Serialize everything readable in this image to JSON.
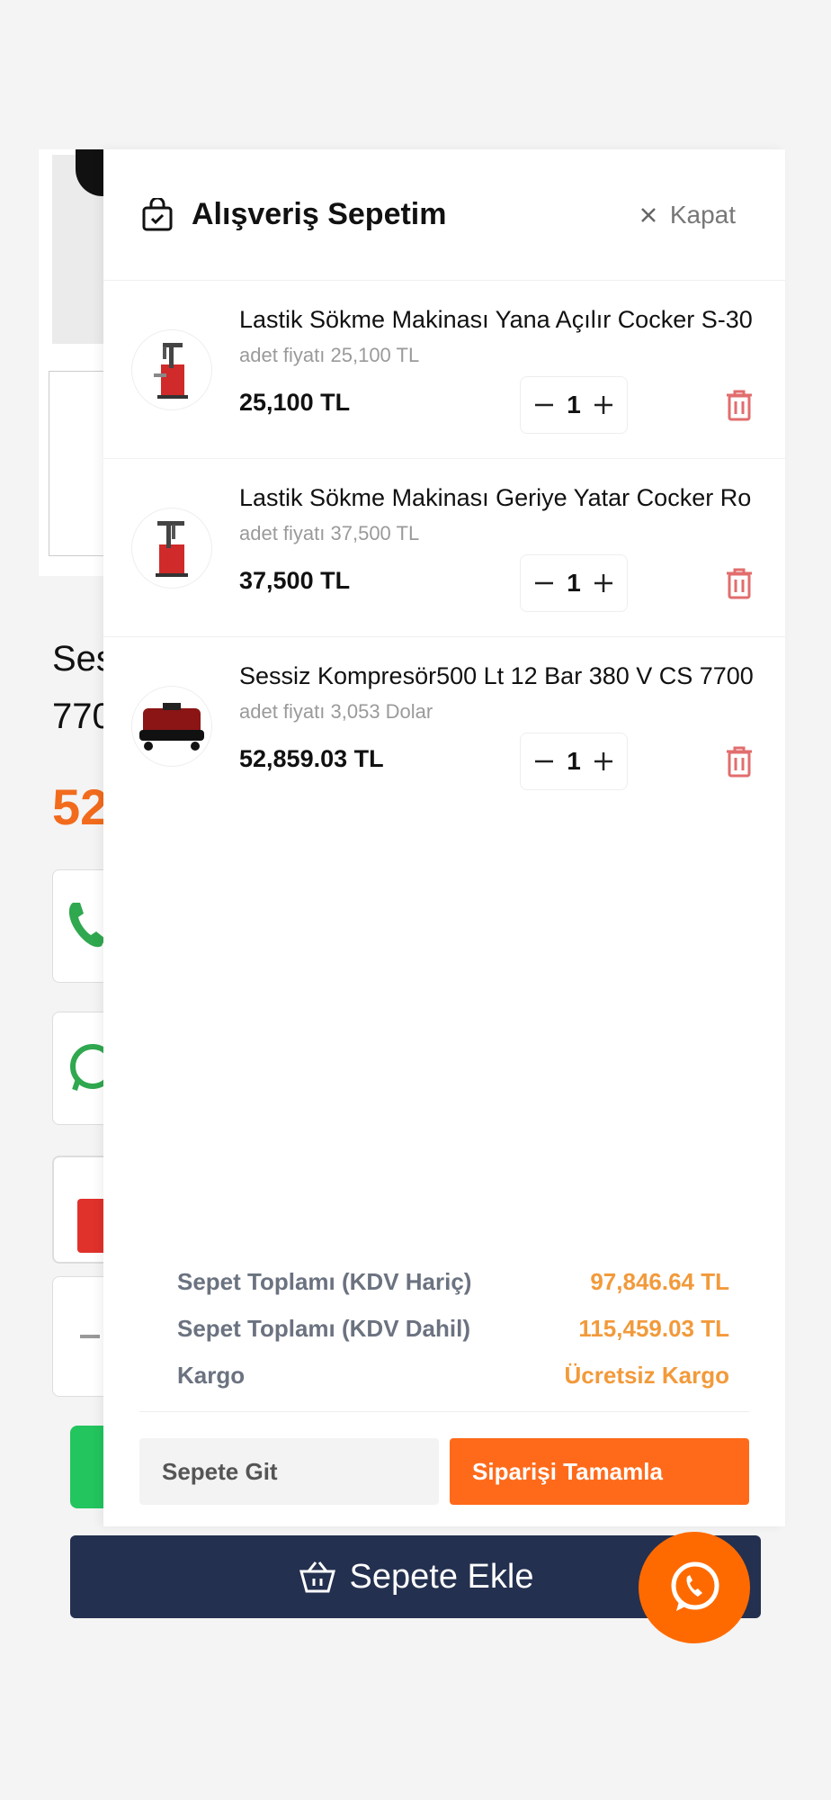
{
  "background": {
    "title_fragment_1": "Ses",
    "title_fragment_2": "770",
    "price_fragment": "52",
    "add_to_cart_label": "Sepete Ekle"
  },
  "cart": {
    "title": "Alışveriş Sepetim",
    "close_label": "Kapat",
    "items": [
      {
        "name": "Lastik Sökme Makinası Yana Açılır Cocker S-30",
        "unit_price": "adet fiyatı 25,100 TL",
        "total": "25,100 TL",
        "quantity": "1"
      },
      {
        "name": "Lastik Sökme Makinası Geriye Yatar Cocker Ro",
        "unit_price": "adet fiyatı 37,500 TL",
        "total": "37,500 TL",
        "quantity": "1"
      },
      {
        "name": "Sessiz Kompresör500 Lt 12 Bar 380 V CS 7700",
        "unit_price": "adet fiyatı 3,053 Dolar",
        "total": "52,859.03 TL",
        "quantity": "1"
      }
    ],
    "summary": [
      {
        "label": "Sepet Toplamı (KDV Hariç)",
        "value": "97,846.64 TL"
      },
      {
        "label": "Sepet Toplamı (KDV Dahil)",
        "value": "115,459.03 TL"
      },
      {
        "label": "Kargo",
        "value": "Ücretsiz Kargo"
      }
    ],
    "go_to_cart_label": "Sepete Git",
    "checkout_label": "Siparişi Tamamla"
  },
  "colors": {
    "accent": "#ff6a1a",
    "summary_value": "#f29a3b",
    "add_cart_bg": "#24304f",
    "trash": "#e26d6d",
    "whatsapp_float": "#ff6a00"
  }
}
